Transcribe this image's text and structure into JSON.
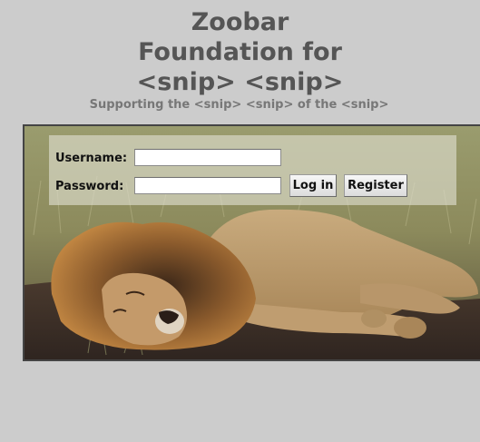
{
  "header": {
    "title_lines": [
      "Zoobar",
      "Foundation for",
      "<snip> <snip>"
    ],
    "tagline": "Supporting the <snip> <snip> of the <snip>"
  },
  "login": {
    "username_label": "Username:",
    "password_label": "Password:",
    "username_value": "",
    "password_value": "",
    "login_button": "Log in",
    "register_button": "Register"
  },
  "colors": {
    "page_background": "#cccccc",
    "title_text": "#555555",
    "tagline_text": "#777777",
    "panel_border": "#444444"
  }
}
